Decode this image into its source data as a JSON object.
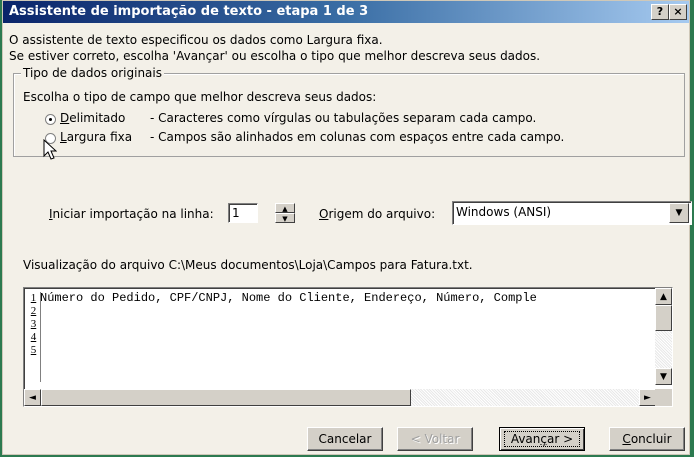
{
  "window": {
    "title": "Assistente de importação de texto - etapa 1 de 3",
    "help_button": "?",
    "close_button": "×"
  },
  "intro": {
    "line1": "O assistente de texto especificou os dados como Largura fixa.",
    "line2": "Se estiver correto, escolha 'Avançar' ou escolha o tipo que melhor descreva seus dados."
  },
  "data_type_group": {
    "label": "Tipo de dados originais",
    "prompt": "Escolha o tipo de campo que melhor descreva seus dados:",
    "options": [
      {
        "label": "Delimitado",
        "description": "- Caracteres como vírgulas ou tabulações separam cada campo.",
        "selected": true
      },
      {
        "label": "Largura fixa",
        "description": "- Campos são alinhados em colunas com espaços entre cada campo.",
        "selected": false
      }
    ]
  },
  "start_row": {
    "label": "Iniciar importação na linha:",
    "value": "1"
  },
  "file_origin": {
    "label": "Origem do arquivo:",
    "value": "Windows (ANSI)"
  },
  "preview": {
    "label": "Visualização do arquivo C:\\Meus documentos\\Loja\\Campos para Fatura.txt.",
    "lines": [
      {
        "num": "1",
        "text": "Número do Pedido, CPF/CNPJ, Nome do Cliente, Endereço, Número, Comple"
      },
      {
        "num": "2",
        "text": ""
      },
      {
        "num": "3",
        "text": ""
      },
      {
        "num": "4",
        "text": ""
      },
      {
        "num": "5",
        "text": ""
      }
    ]
  },
  "buttons": {
    "cancel": "Cancelar",
    "back": "< Voltar",
    "next": "Avançar >",
    "finish": "Concluir"
  },
  "icons": {
    "arrow_up": "▲",
    "arrow_down": "▼",
    "arrow_left": "◄",
    "arrow_right": "►"
  },
  "colors": {
    "title_gradient_start": "#0a246a",
    "title_gradient_end": "#a6caf0",
    "dialog_face": "#f3f0e8"
  }
}
